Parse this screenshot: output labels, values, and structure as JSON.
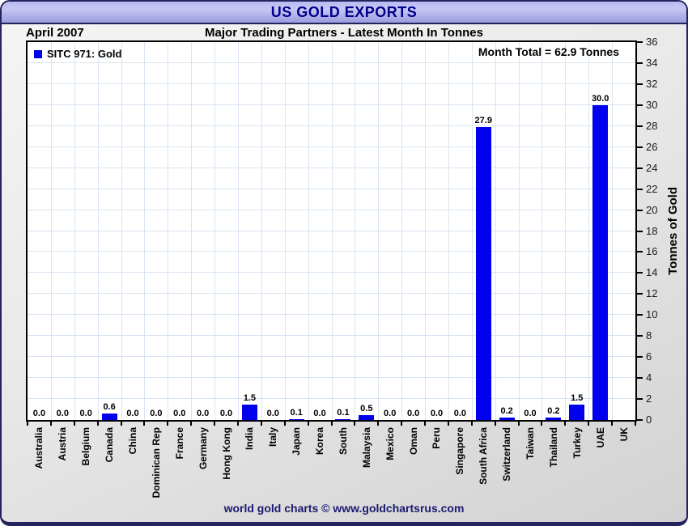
{
  "window": {
    "title": "US GOLD EXPORTS"
  },
  "header": {
    "period": "April 2007",
    "subtitle": "Major Trading Partners - Latest Month In Tonnes"
  },
  "legend": {
    "label": "SITC 971: Gold"
  },
  "annotation": {
    "month_total": "Month Total = 62.9 Tonnes"
  },
  "footer": {
    "credit": "world gold charts © www.goldchartsrus.com"
  },
  "colors": {
    "bar": "#0000ee",
    "grid": "#d9e4f2",
    "header_text": "#00008b",
    "footer_text": "#191970",
    "titlebar_fill": "#b9b9f2"
  },
  "chart_data": {
    "type": "bar",
    "title": "Major Trading Partners - Latest Month In Tonnes",
    "period": "April 2007",
    "header_banner": "US GOLD EXPORTS",
    "legend_entries": [
      "SITC 971: Gold"
    ],
    "annotation": "Month Total = 62.9 Tonnes",
    "month_total_tonnes": 62.9,
    "xlabel": "",
    "ylabel": "Tonnes of Gold",
    "ylim": [
      0,
      36
    ],
    "ytick_step": 2,
    "grid": true,
    "legend_position": "top-left",
    "categories": [
      "Australia",
      "Austria",
      "Belgium",
      "Canada",
      "China",
      "Dominican Rep",
      "France",
      "Germany",
      "Hong Kong",
      "India",
      "Italy",
      "Japan",
      "Korea",
      "South",
      "Malaysia",
      "Mexico",
      "Oman",
      "Peru",
      "Singapore",
      "South Africa",
      "Switzerland",
      "Taiwan",
      "Thailand",
      "Turkey",
      "UAE",
      "UK"
    ],
    "values": [
      0.0,
      0.0,
      0.0,
      0.6,
      0.0,
      0.0,
      0.0,
      0.0,
      0.0,
      1.5,
      0.0,
      0.1,
      0.0,
      0.1,
      0.5,
      0.0,
      0.0,
      0.0,
      0.0,
      27.9,
      0.2,
      0.0,
      0.2,
      1.5,
      30.0,
      0.0
    ],
    "bar_labels": [
      "0.0",
      "0.0",
      "0.0",
      "0.6",
      "0.0",
      "0.0",
      "0.0",
      "0.0",
      "0.0",
      "1.5",
      "0.0",
      "0.1",
      "0.0",
      "0.1",
      "0.5",
      "0.0",
      "0.0",
      "0.0",
      "0.0",
      "27.9",
      "0.2",
      "0.0",
      "0.2",
      "1.5",
      "30.0",
      ""
    ]
  }
}
